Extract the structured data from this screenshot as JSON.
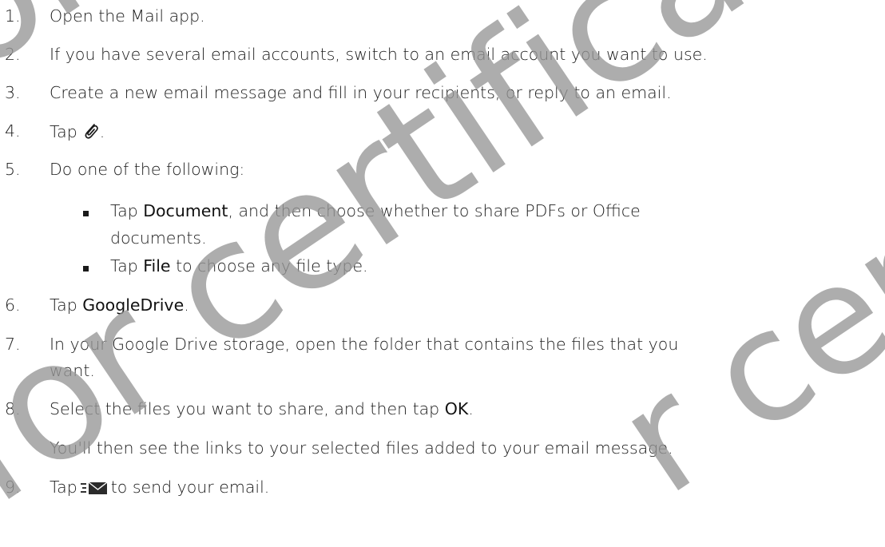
{
  "steps": [
    {
      "num": "1.",
      "text": "Open the Mail app."
    },
    {
      "num": "2.",
      "text": "If you have several email accounts, switch to an email account you want to use."
    },
    {
      "num": "3.",
      "text": "Create a new email message and fill in your recipients, or reply to an email."
    },
    {
      "num": "4.",
      "pre": "Tap",
      "post": "."
    },
    {
      "num": "5.",
      "text": "Do one of the following:"
    },
    {
      "num": "6.",
      "pre": "Tap ",
      "ui": "GoogleDrive",
      "post": "."
    },
    {
      "num": "7.",
      "line1": "In your Google Drive storage, open the folder that contains the files that you",
      "line2": "want."
    },
    {
      "num": "8.",
      "pre": "Select the files you want to share, and then tap ",
      "ui": "OK",
      "post": "."
    },
    {
      "num": "9.",
      "pre": "Tap",
      "post": "to send your email."
    }
  ],
  "bullets": [
    {
      "pre": "Tap ",
      "ui": "Document",
      "line1_post": ", and then choose whether to share PDFs or Office",
      "line2": "documents."
    },
    {
      "pre": "Tap ",
      "ui": "File",
      "post": " to choose any file type."
    }
  ],
  "note": "You'll then see the links to your selected files added to your email message.",
  "icons": {
    "attach": "paperclip-icon",
    "send": "send-mail-icon"
  },
  "watermark": {
    "text_1": "for certificatio",
    "text_2": "for certificatio",
    "text_3": "r certific",
    "color": "#969696"
  }
}
